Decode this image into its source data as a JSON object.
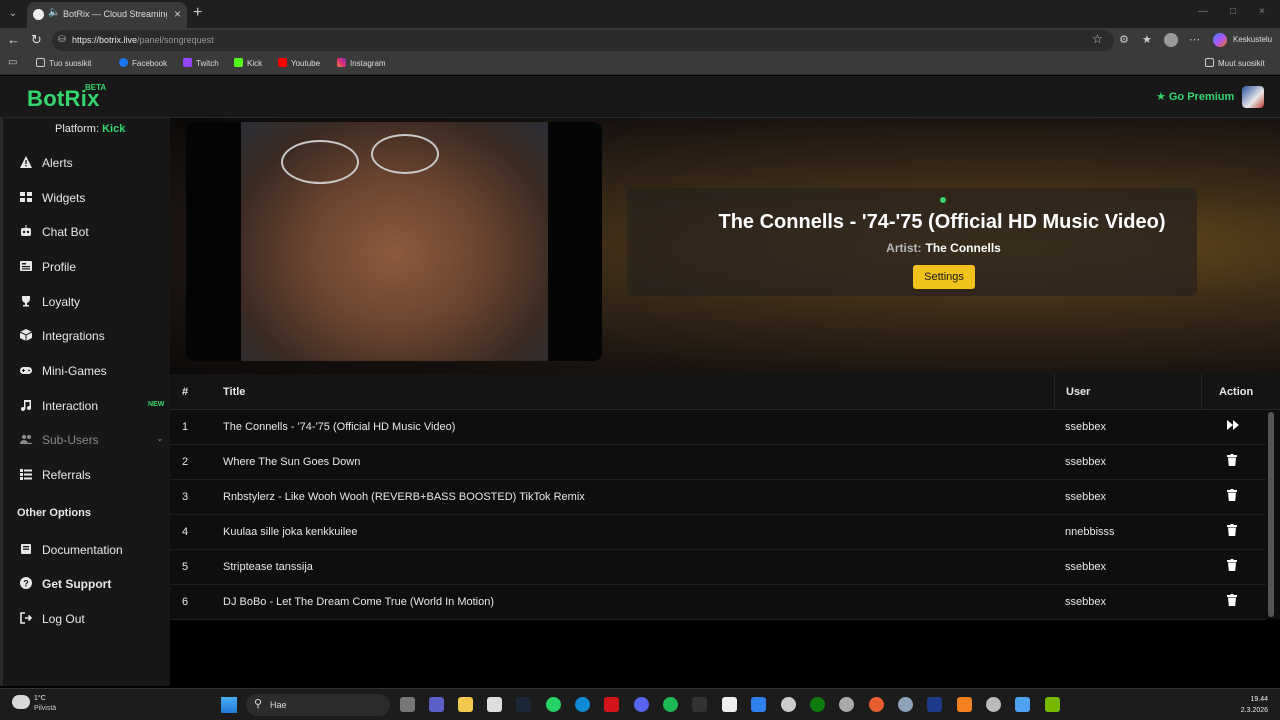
{
  "browser": {
    "tab_title": "BotRix — Cloud Streaming Bot",
    "url_host": "https://botrix.live",
    "url_path": "/panel/songrequest",
    "copilot_label": "Keskustelu",
    "bookmarks": [
      "Tuo suosikit",
      "Facebook",
      "Twitch",
      "Kick",
      "Youtube",
      "Instagram"
    ],
    "other_bookmarks": "Muut suosikit"
  },
  "header": {
    "logo": "BotRix",
    "beta": "BETA",
    "premium_label": "Go Premium"
  },
  "sidebar": {
    "platform_label": "Platform:",
    "platform_name": "Kick",
    "items": [
      {
        "label": "Alerts",
        "icon": "warning-icon"
      },
      {
        "label": "Widgets",
        "icon": "grid-icon"
      },
      {
        "label": "Chat Bot",
        "icon": "robot-icon"
      },
      {
        "label": "Profile",
        "icon": "id-card-icon"
      },
      {
        "label": "Loyalty",
        "icon": "trophy-icon"
      },
      {
        "label": "Integrations",
        "icon": "cube-icon"
      },
      {
        "label": "Mini-Games",
        "icon": "gamepad-icon"
      },
      {
        "label": "Interaction",
        "icon": "music-icon",
        "badge": "NEW"
      },
      {
        "label": "Sub-Users",
        "icon": "users-icon"
      },
      {
        "label": "Referrals",
        "icon": "list-icon"
      }
    ],
    "other_options_title": "Other Options",
    "other_items": [
      {
        "label": "Documentation",
        "icon": "book-icon"
      },
      {
        "label": "Get Support",
        "icon": "question-icon"
      },
      {
        "label": "Log Out",
        "icon": "logout-icon"
      }
    ]
  },
  "now_playing": {
    "title": "The Connells - '74-'75 (Official HD Music Video)",
    "artist_label": "Artist:",
    "artist": "The Connells",
    "settings_label": "Settings"
  },
  "queue": {
    "columns": [
      "#",
      "Title",
      "User",
      "Action"
    ],
    "rows": [
      {
        "num": "1",
        "title": "The Connells - '74-'75 (Official HD Music Video)",
        "user": "ssebbex",
        "action": "skip-icon"
      },
      {
        "num": "2",
        "title": "Where The Sun Goes Down",
        "user": "ssebbex",
        "action": "trash-icon"
      },
      {
        "num": "3",
        "title": "Rnbstylerz - Like Wooh Wooh (REVERB+BASS BOOSTED) TikTok Remix",
        "user": "ssebbex",
        "action": "trash-icon"
      },
      {
        "num": "4",
        "title": "Kuulaa sille joka kenkkuilee",
        "user": "nnebbisss",
        "action": "trash-icon"
      },
      {
        "num": "5",
        "title": "Striptease tanssija",
        "user": "ssebbex",
        "action": "trash-icon"
      },
      {
        "num": "6",
        "title": "DJ BoBo - Let The Dream Come True (World In Motion)",
        "user": "ssebbex",
        "action": "trash-icon"
      }
    ]
  },
  "taskbar": {
    "weather_temp": "1°C",
    "weather_desc": "Pilvistä",
    "search_placeholder": "Hae",
    "time": "19.44",
    "date": "2.3.2026"
  }
}
